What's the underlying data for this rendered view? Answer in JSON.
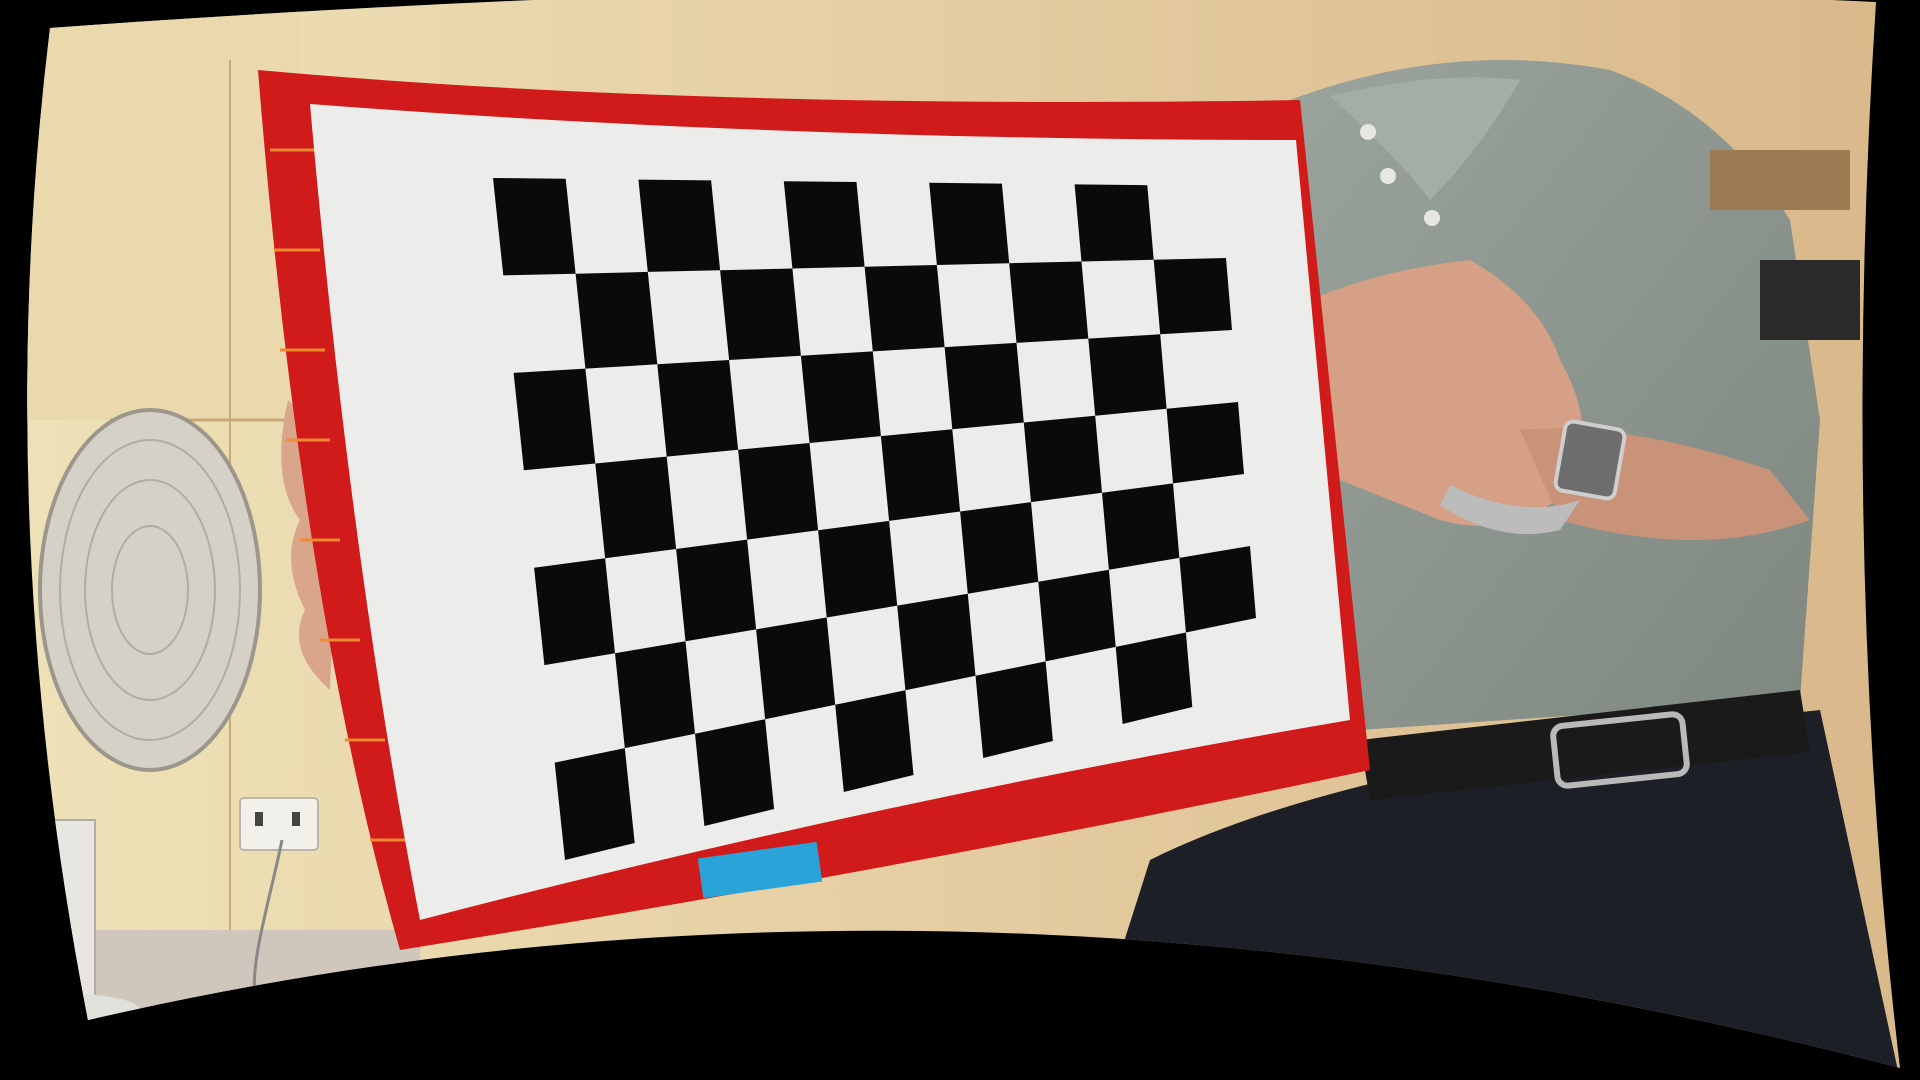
{
  "image": {
    "kind": "undistorted-camera-photo",
    "subject": "checkerboard-calibration-target",
    "board": {
      "inner_columns": 9,
      "inner_rows": 6,
      "total_columns": 10,
      "total_rows": 7
    },
    "colors": {
      "background": "#000000",
      "wall": "#e6c99a",
      "paper": "#ececea",
      "square": "#0a0a0a",
      "board_frame": "#d11a1a",
      "shirt": "#8e9890",
      "pants": "#1c1f26",
      "belt": "#1a1a1a",
      "skin": "#d9a68c"
    }
  }
}
